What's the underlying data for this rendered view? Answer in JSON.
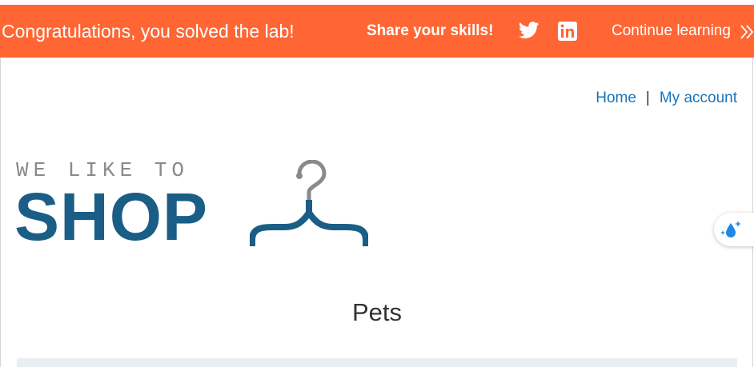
{
  "banner": {
    "message": "Congratulations, you solved the lab!",
    "share_label": "Share your skills!",
    "twitter_icon": "twitter-icon",
    "linkedin_icon": "linkedin-icon",
    "continue_label": "Continue learning",
    "continue_icon": "double-chevron-right-icon",
    "background_color": "#ff6633"
  },
  "nav": {
    "items": [
      {
        "label": "Home"
      },
      {
        "label": "My account"
      }
    ],
    "separator": "|",
    "link_color": "#1a73b8"
  },
  "logo": {
    "tagline": "WE LIKE TO",
    "word": "SHOP",
    "icon": "hanger-icon",
    "brand_color": "#1a5e86"
  },
  "floating_button": {
    "icon": "sparkle-droplet-icon"
  },
  "main": {
    "heading": "Pets"
  }
}
